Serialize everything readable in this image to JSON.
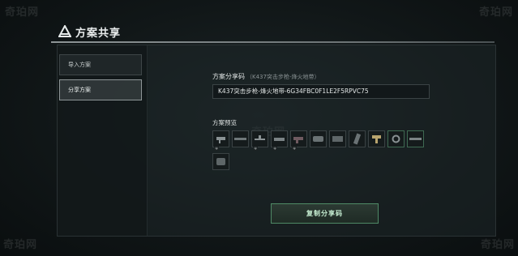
{
  "watermark": "奇珀网",
  "panel": {
    "title": "方案共享"
  },
  "sidebar": {
    "items": [
      {
        "label": "导入方案"
      },
      {
        "label": "分享方案"
      }
    ]
  },
  "share": {
    "code_label": "方案分享码",
    "code_sublabel": "（K437突击步枪-烽火地带）",
    "code_value": "K437突击步枪-烽火地带-6G34FBC0F1LE2F5RPVC75",
    "preview_label": "方案预览",
    "slot_tag": "∓",
    "copy_button": "复制分享码"
  },
  "colors": {
    "accent_green": "#4f8a66",
    "panel_bg": "#111718"
  },
  "preview_slots": [
    {
      "icon": "scope-icon",
      "tag": true
    },
    {
      "icon": "barrel-icon",
      "tag": false
    },
    {
      "icon": "sight-icon",
      "tag": true
    },
    {
      "icon": "rail-icon",
      "tag": true
    },
    {
      "icon": "grip-icon",
      "tag": true
    },
    {
      "icon": "handguard-icon",
      "tag": false
    },
    {
      "icon": "stock-icon",
      "tag": false
    },
    {
      "icon": "magazine-icon",
      "tag": false
    },
    {
      "icon": "laser-icon",
      "tag": false
    },
    {
      "icon": "trigger-icon",
      "tag": false
    },
    {
      "icon": "muzzle-icon",
      "tag": false
    },
    {
      "icon": "receiver-icon",
      "tag": false
    },
    {
      "icon": "pad-icon",
      "tag": false
    }
  ]
}
